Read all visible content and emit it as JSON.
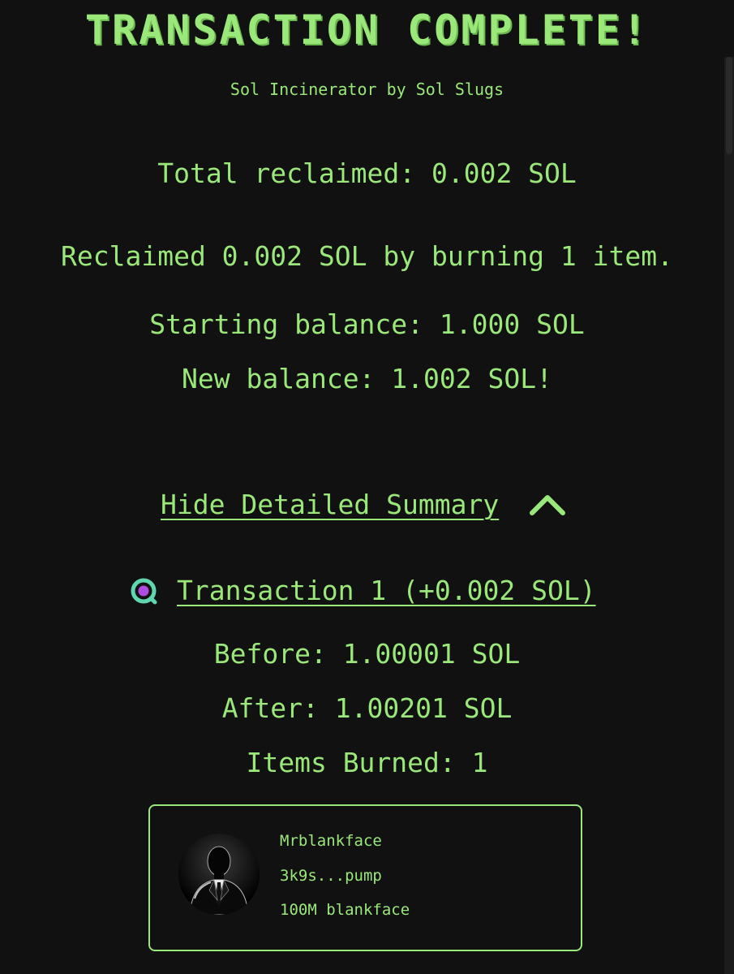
{
  "header": {
    "title": "TRANSACTION COMPLETE!",
    "subtitle": "Sol Incinerator by Sol Slugs"
  },
  "summary": {
    "total_reclaimed": "Total reclaimed: 0.002 SOL",
    "reclaimed_message": "Reclaimed 0.002 SOL by burning 1 item.",
    "starting_balance": "Starting balance: 1.000 SOL",
    "new_balance": "New balance: 1.002 SOL!"
  },
  "details_toggle": {
    "label": "Hide Detailed Summary",
    "icon": "chevron-up-icon"
  },
  "transactions": [
    {
      "label": "Transaction 1 (+0.002 SOL)",
      "icon": "solana-explorer-icon",
      "before": "Before: 1.00001 SOL",
      "after": "After: 1.00201 SOL",
      "items_burned": "Items Burned: 1",
      "items": [
        {
          "name": "Mrblankface",
          "mint": "3k9s...pump",
          "amount": "100M blankface",
          "avatar": "suited-silhouette-avatar"
        }
      ]
    }
  ],
  "colors": {
    "background": "#111111",
    "accent": "#9be87a",
    "icon_ring": "#5fd6b0",
    "icon_core": "#b04ae0"
  }
}
